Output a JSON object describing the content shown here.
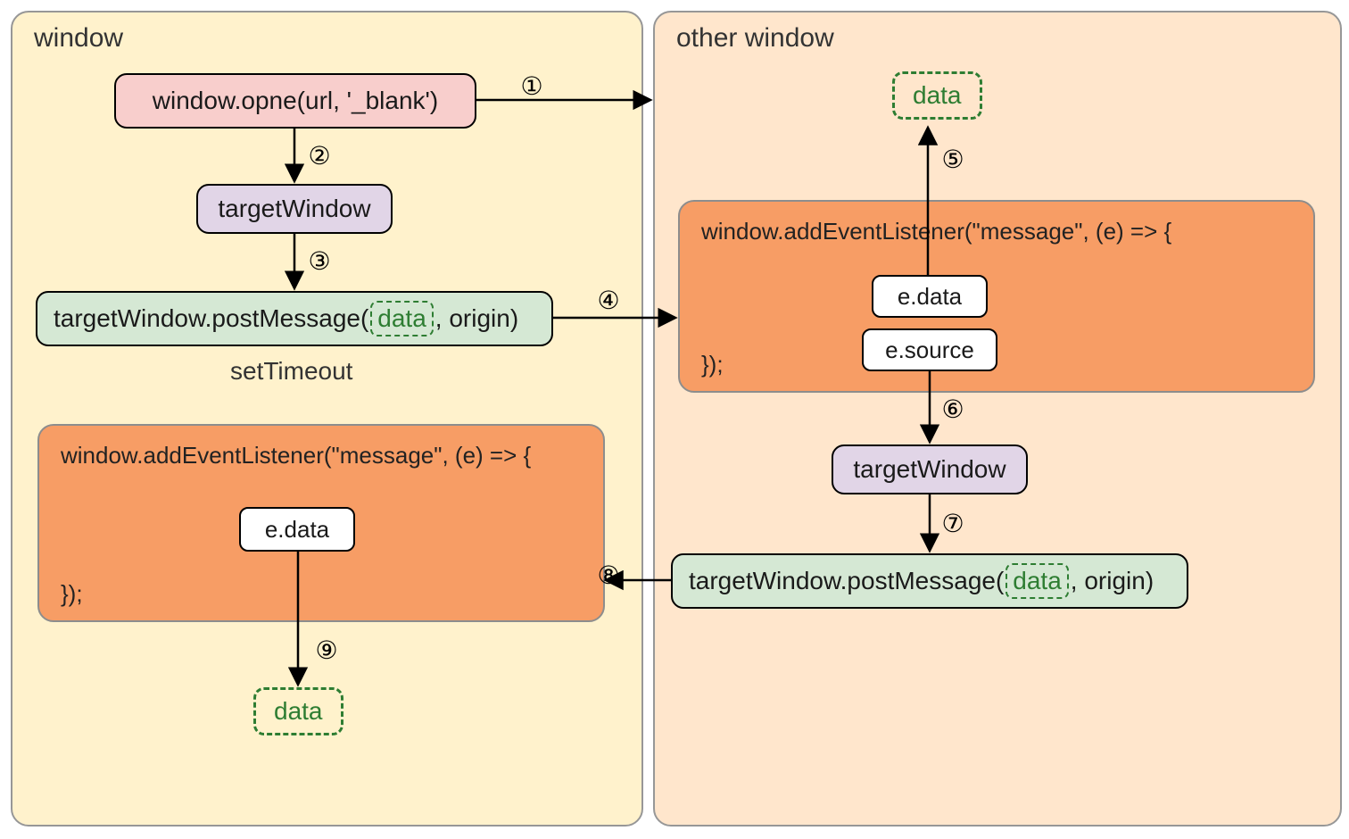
{
  "left": {
    "title": "window",
    "box1": "window.opne(url, '_blank')",
    "box2": "targetWindow",
    "box3_prefix": "targetWindow.postMessage(",
    "box3_data": "data",
    "box3_suffix": ", origin)",
    "setTimeout": "setTimeout",
    "listener_open": "window.addEventListener(\"message\", (e) => {",
    "listener_close": "});",
    "eData": "e.data",
    "data": "data"
  },
  "right": {
    "title": "other window",
    "data": "data",
    "listener_open": "window.addEventListener(\"message\", (e) => {",
    "listener_close": "});",
    "eData": "e.data",
    "eSource": "e.source",
    "targetWindow": "targetWindow",
    "post_prefix": "targetWindow.postMessage(",
    "post_data": "data",
    "post_suffix": ", origin)"
  },
  "steps": {
    "s1": "①",
    "s2": "②",
    "s3": "③",
    "s4": "④",
    "s5": "⑤",
    "s6": "⑥",
    "s7": "⑦",
    "s8": "⑧",
    "s9": "⑨"
  }
}
